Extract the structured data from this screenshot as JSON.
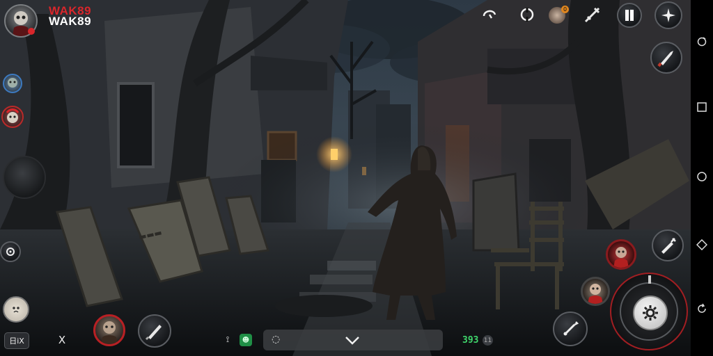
{
  "player": {
    "name_line1": "WAK89",
    "name_line2": "WAK89"
  },
  "hud_top": {
    "notification_badge": "0"
  },
  "bottom_bar": {
    "chat_placeholder": "",
    "counter_value": "393",
    "counter_icon": "11",
    "lang_label": "日iX",
    "close_label": "X"
  },
  "colors": {
    "accent_red": "#d8262b",
    "counter_green": "#3fd66b",
    "hud_dark": "#15171a"
  },
  "icons": {
    "top": [
      "player-avatar",
      "sound-icon",
      "refresh-icon",
      "character-avatar-badge",
      "weapon-icon",
      "pause-icon",
      "compass-icon"
    ],
    "right": [
      "knife-icon",
      "attack-joystick",
      "skill-icon",
      "crosshair-icon"
    ],
    "nav": [
      "circle-back-icon",
      "square-recents-icon",
      "circle-home-icon",
      "diamond-icon",
      "rotate-icon"
    ]
  }
}
